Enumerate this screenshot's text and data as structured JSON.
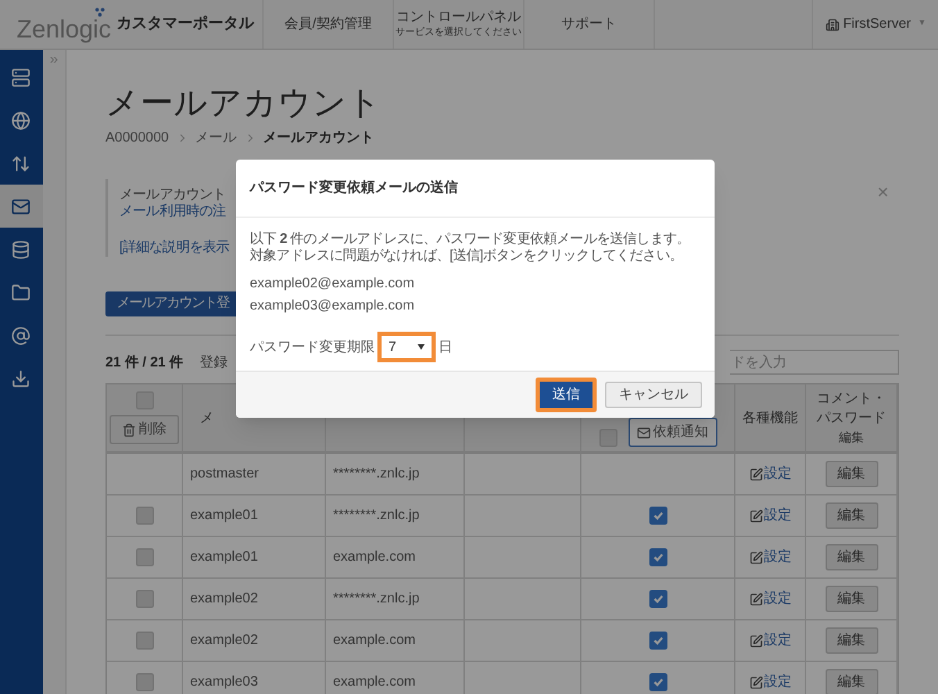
{
  "header": {
    "brand": "Zenlogic",
    "subtitle": "カスタマーポータル",
    "nav": [
      {
        "label": "会員/契約管理"
      },
      {
        "label": "コントロールパネル",
        "sub": "サービスを選択してください"
      },
      {
        "label": "サポート"
      }
    ],
    "account": {
      "name": "FirstServer",
      "caret": "▼"
    }
  },
  "sidebar": {
    "toggle": "»",
    "items": [
      {
        "kind": "servers",
        "selected": false
      },
      {
        "kind": "globe",
        "selected": false
      },
      {
        "kind": "transfer",
        "selected": false
      },
      {
        "kind": "mail",
        "selected": true
      },
      {
        "kind": "database",
        "selected": false
      },
      {
        "kind": "folder",
        "selected": false
      },
      {
        "kind": "at",
        "selected": false
      },
      {
        "kind": "download",
        "selected": false
      }
    ]
  },
  "page": {
    "title": "メールアカウント",
    "breadcrumb": [
      {
        "label": "A0000000",
        "current": false
      },
      {
        "label": "メール",
        "current": false
      },
      {
        "label": "メールアカウント",
        "current": true
      }
    ]
  },
  "notice": {
    "title": "メールアカウント",
    "note": "メール利用時の注",
    "link": "[詳細な説明を表示",
    "close": "×"
  },
  "register_button": "メールアカウント登",
  "count": "21 件 / 21 件",
  "registered_label": "登録",
  "search": {
    "placeholder": "ドを入力"
  },
  "table": {
    "columns": [
      {
        "kind": "select",
        "checked": false,
        "button": "削除"
      },
      {
        "kind": "text",
        "label": "メ"
      },
      {
        "kind": "empty"
      },
      {
        "kind": "empty"
      },
      {
        "kind": "notify",
        "checked": false,
        "button": "依頼通知"
      },
      {
        "kind": "text",
        "label": "各種機能"
      },
      {
        "kind": "lines",
        "lines": [
          "コメント・",
          "パスワード",
          "編集"
        ]
      }
    ],
    "rows": [
      {
        "kind": "system",
        "name": "postmaster",
        "domain": "********.znlc.jp",
        "action": "設定",
        "edit": "編集"
      },
      {
        "kind": "user",
        "selected": false,
        "name": "example01",
        "domain": "********.znlc.jp",
        "notify": true,
        "action": "設定",
        "edit": "編集"
      },
      {
        "kind": "user",
        "selected": false,
        "name": "example01",
        "domain": "example.com",
        "notify": true,
        "action": "設定",
        "edit": "編集"
      },
      {
        "kind": "user",
        "selected": false,
        "name": "example02",
        "domain": "********.znlc.jp",
        "notify": true,
        "action": "設定",
        "edit": "編集"
      },
      {
        "kind": "user",
        "selected": false,
        "name": "example02",
        "domain": "example.com",
        "notify": true,
        "action": "設定",
        "edit": "編集"
      },
      {
        "kind": "user",
        "selected": false,
        "name": "example03",
        "domain": "example.com",
        "notify": true,
        "action": "設定",
        "edit": "編集"
      }
    ]
  },
  "dialog": {
    "title": "パスワード変更依頼メールの送信",
    "message": [
      "以下 **2** 件のメールアドレスに、パスワード変更依頼メールを送信します。",
      "対象アドレスに問題がなければ、[送信]ボタンをクリックしてください。"
    ],
    "addresses": [
      "example02@example.com",
      "example03@example.com"
    ],
    "period": {
      "label": "パスワード変更期限",
      "value": "7",
      "unit": "日",
      "highlighted": true
    },
    "buttons": [
      {
        "label": "送信",
        "kind": "primary",
        "highlighted": true
      },
      {
        "label": "キャンセル",
        "kind": "secondary",
        "highlighted": false
      }
    ]
  }
}
